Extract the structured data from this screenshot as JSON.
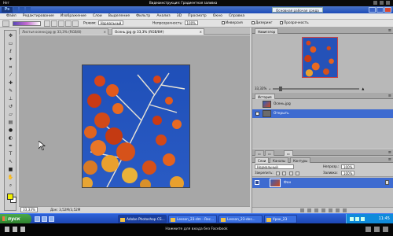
{
  "video_top": {
    "left_text": "Нет",
    "center_text": "Видеоинструкция: Градиентная заливка"
  },
  "photoshop": {
    "logo": "Ps",
    "workspace": "Основная рабочая среда",
    "menu": [
      "Файл",
      "Редактирование",
      "Изображение",
      "Слои",
      "Выделение",
      "Фильтр",
      "Анализ",
      "3D",
      "Просмотр",
      "Окно",
      "Справка"
    ],
    "options": {
      "mode_label": "Режим:",
      "mode_value": "Нормальный",
      "opacity_label": "Непрозрачность:",
      "opacity_value": "100%",
      "reverse_label": "Инверсия",
      "dither_label": "Дизеринг",
      "transparency_label": "Прозрачность"
    },
    "doc_tabs": [
      {
        "label": "Листья осени.jpg @ 33,3% (RGB/8)"
      },
      {
        "label": "Осень.jpg @ 33,3% (RGB/8#)"
      }
    ],
    "status": {
      "zoom": "33,33%",
      "doc_info": "Док: 3,52M/3,52M"
    },
    "navigator": {
      "tabs": [
        "Навигатор"
      ],
      "zoom": "33,33%"
    },
    "history": {
      "tabs": [
        "История"
      ],
      "items": [
        "Осень.jpg",
        "Открыть"
      ],
      "selected_index": 1
    },
    "layers": {
      "tabs": [
        "Слои",
        "Каналы",
        "Контуры"
      ],
      "blend": "Нормальный",
      "opacity_label": "Непрозр.:",
      "opacity_value": "100%",
      "lock_label": "Закрепить:",
      "fill_label": "Заливка:",
      "fill_value": "100%",
      "items": [
        {
          "name": "Фон"
        }
      ]
    },
    "colors": {
      "foreground": "#f2f000",
      "background": "#ffffff",
      "accent": "#3e6bd0"
    }
  },
  "taskbar": {
    "start_label": "пуск",
    "tasks": [
      {
        "label": "Adobe Photoshop CS...",
        "active": true
      },
      {
        "label": "Lesson_23-dm - Rec..."
      },
      {
        "label": "Lesson_23-des..."
      },
      {
        "label": "Урок_23"
      }
    ],
    "clock": "11:45"
  },
  "video_bottom": {
    "message": "Нажмите для входа без Facebook"
  },
  "icons": [
    "move-icon",
    "marquee-icon",
    "lasso-icon",
    "magic-wand-icon",
    "crop-icon",
    "eyedropper-icon",
    "healing-icon",
    "brush-icon",
    "clone-stamp-icon",
    "history-brush-icon",
    "eraser-icon",
    "gradient-icon",
    "blur-icon",
    "dodge-icon",
    "pen-icon",
    "type-icon",
    "path-select-icon",
    "shape-icon",
    "hand-icon",
    "zoom-icon"
  ]
}
